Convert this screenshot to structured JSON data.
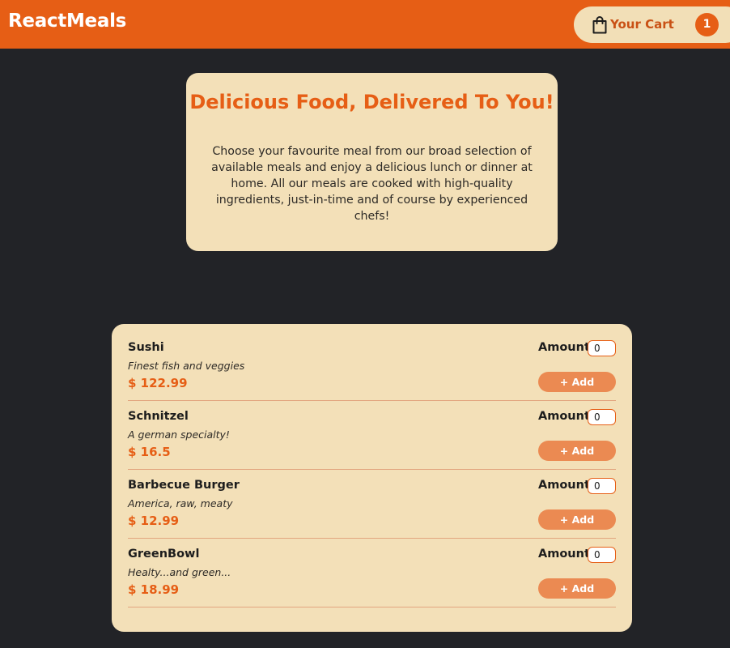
{
  "header": {
    "brand": "ReactMeals",
    "cart": {
      "icon": "shopping-bag-icon",
      "label": "Your Cart",
      "count": "1"
    }
  },
  "summary": {
    "title": "Delicious Food, Delivered To You!",
    "text": "Choose your favourite meal from our broad selection of available meals and enjoy a delicious lunch or dinner at home. All our meals are cooked with high-quality ingredients, just-in-time and of course by experienced chefs!"
  },
  "meals": [
    {
      "name": "Sushi",
      "description": "Finest fish and veggies",
      "price": "$ 122.99",
      "amount_label": "Amount",
      "amount_value": "0",
      "add_label": "+ Add"
    },
    {
      "name": "Schnitzel",
      "description": "A german specialty!",
      "price": "$ 16.5",
      "amount_label": "Amount",
      "amount_value": "0",
      "add_label": "+ Add"
    },
    {
      "name": "Barbecue Burger",
      "description": "America, raw, meaty",
      "price": "$ 12.99",
      "amount_label": "Amount",
      "amount_value": "0",
      "add_label": "+ Add"
    },
    {
      "name": "GreenBowl",
      "description": "Healty...and green...",
      "price": "$ 18.99",
      "amount_label": "Amount",
      "amount_value": "0",
      "add_label": "+ Add"
    }
  ],
  "colors": {
    "brand": "#e65e15",
    "background": "#222327",
    "card": "#f3e0b8",
    "add_button": "#eb8a52"
  }
}
